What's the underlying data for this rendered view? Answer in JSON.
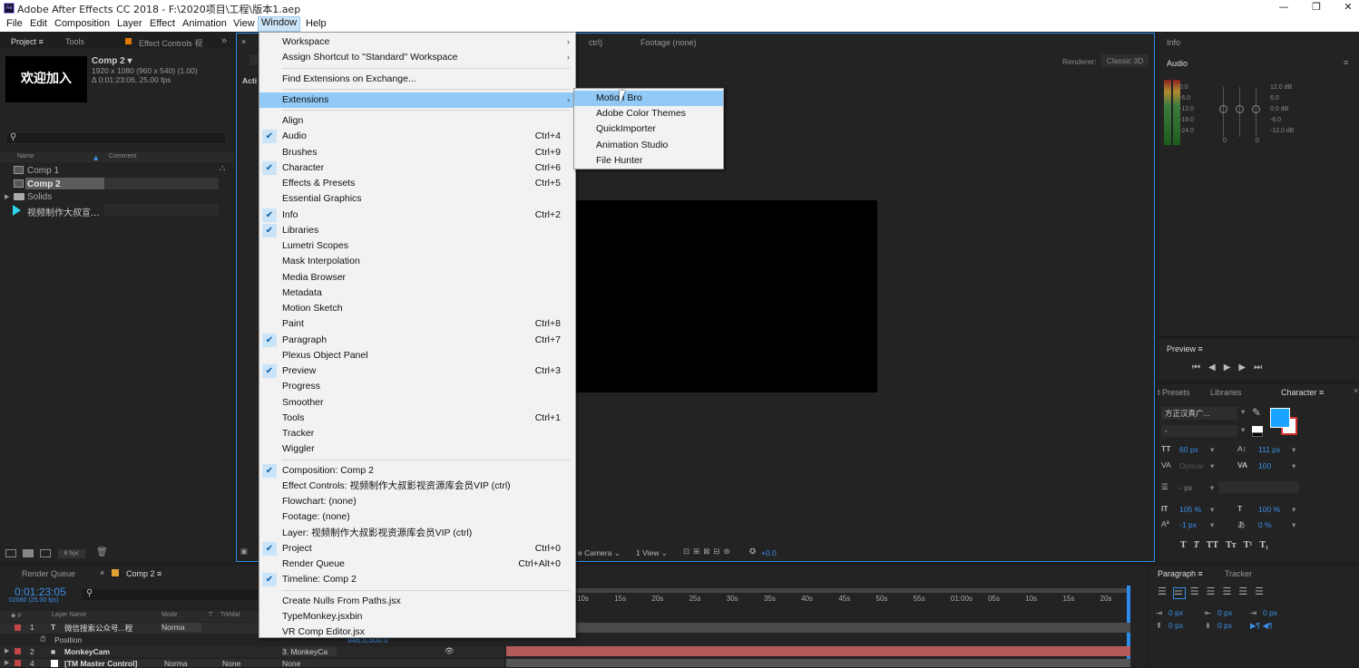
{
  "window": {
    "title": "Adobe After Effects CC 2018 - F:\\2020项目\\工程\\版本1.aep",
    "app_icon": "Ae",
    "minimize": "—",
    "maximize": "❐",
    "close": "✕"
  },
  "menubar": [
    "File",
    "Edit",
    "Composition",
    "Layer",
    "Effect",
    "Animation",
    "View",
    "Window",
    "Help"
  ],
  "project_panel": {
    "tab_project": "Project",
    "tab_tools": "Tools",
    "tab_effect_controls": "Effect Controls 视",
    "comp_name": "Comp 2 ▾",
    "comp_res": "1920 x 1080  (960 x 540) (1.00)",
    "comp_dur": "Δ 0:01:23:06, 25.00 fps",
    "thumb_text": "欢迎加入",
    "col_name": "Name",
    "col_comment": "Comment",
    "items": [
      "Comp 1",
      "Comp 2",
      "Solids",
      "视频制作大叔宣..."
    ],
    "bpc": "8 bpc"
  },
  "viewer": {
    "footage_tab": "Footage (none)",
    "ctrl_tab": "ctrl)",
    "renderer_label": "Renderer:",
    "renderer_value": "Classic 3D",
    "active_label": "Acti",
    "camera": "e Camera",
    "view": "1 View",
    "exposure": "+0.0"
  },
  "info_panel": {
    "tab_info": "Info",
    "tab_audio": "Audio",
    "audio_left": [
      "0.0",
      "-6.0",
      "-12.0",
      "-18.0",
      "-24.0"
    ],
    "audio_right": [
      "12.0 dB",
      "6.0",
      "0.0 dB",
      "-6.0",
      "-12.0 dB"
    ],
    "audio_bottom": [
      "0",
      "0"
    ]
  },
  "preview_panel": {
    "title": "Preview"
  },
  "character_panel": {
    "tab_presets": "t Presets",
    "tab_libraries": "Libraries",
    "tab_character": "Character",
    "font": "方正汉真广...",
    "style": "-",
    "size": "60 px",
    "leading": "111 px",
    "kerning": "Optical",
    "tracking": "100",
    "stroke": "- px",
    "vscale": "105 %",
    "hscale": "100 %",
    "baseline": "-1 px",
    "tsume": "0 %",
    "fill_color": "#1aa3ff",
    "styles": [
      "T",
      "T",
      "TT",
      "Tт",
      "T¹",
      "T₁"
    ]
  },
  "paragraph_panel": {
    "tab_paragraph": "Paragraph",
    "tab_tracker": "Tracker",
    "values": [
      "0 px",
      "0 px",
      "0 px",
      "0 px",
      "0 px"
    ]
  },
  "timeline": {
    "tab_render_queue": "Render Queue",
    "tab_comp": "Comp 2",
    "timecode": "0:01:23:05",
    "frame": "02080 (25.00 fps)",
    "col_layer": "Layer Name",
    "col_mode": "Mode",
    "col_t": "T",
    "col_trkmat": "TrkMat",
    "ruler": [
      "10s",
      "15s",
      "20s",
      "25s",
      "30s",
      "35s",
      "40s",
      "45s",
      "50s",
      "55s",
      "01:00s",
      "05s",
      "10s",
      "15s",
      "20s"
    ],
    "layers": [
      {
        "num": "1",
        "name": "微信搜索公众号...程",
        "mode": "Norma",
        "parent": ""
      },
      {
        "num": "",
        "name": "Position",
        "mode": "",
        "parent": "946.0,600.0"
      },
      {
        "num": "2",
        "name": "MonkeyCam",
        "mode": "",
        "parent": "3. MonkeyCa"
      },
      {
        "num": "4",
        "name": "[TM Master Control]",
        "mode": "Norma",
        "parent": "None"
      }
    ],
    "none_label": "None"
  },
  "window_menu": {
    "items": [
      {
        "label": "Workspace",
        "shortcut": "",
        "checked": false,
        "submenu": true
      },
      {
        "label": "Assign Shortcut to \"Standard\" Workspace",
        "shortcut": "",
        "checked": false,
        "submenu": true
      },
      {
        "sep": true
      },
      {
        "label": "Find Extensions on Exchange...",
        "shortcut": "",
        "checked": false
      },
      {
        "sep": true
      },
      {
        "label": "Extensions",
        "shortcut": "",
        "checked": false,
        "submenu": true,
        "highlighted": true
      },
      {
        "sep": true
      },
      {
        "label": "Align",
        "shortcut": "",
        "checked": false
      },
      {
        "label": "Audio",
        "shortcut": "Ctrl+4",
        "checked": true
      },
      {
        "label": "Brushes",
        "shortcut": "Ctrl+9",
        "checked": false
      },
      {
        "label": "Character",
        "shortcut": "Ctrl+6",
        "checked": true
      },
      {
        "label": "Effects & Presets",
        "shortcut": "Ctrl+5",
        "checked": false
      },
      {
        "label": "Essential Graphics",
        "shortcut": "",
        "checked": false
      },
      {
        "label": "Info",
        "shortcut": "Ctrl+2",
        "checked": true
      },
      {
        "label": "Libraries",
        "shortcut": "",
        "checked": true
      },
      {
        "label": "Lumetri Scopes",
        "shortcut": "",
        "checked": false
      },
      {
        "label": "Mask Interpolation",
        "shortcut": "",
        "checked": false
      },
      {
        "label": "Media Browser",
        "shortcut": "",
        "checked": false
      },
      {
        "label": "Metadata",
        "shortcut": "",
        "checked": false
      },
      {
        "label": "Motion Sketch",
        "shortcut": "",
        "checked": false
      },
      {
        "label": "Paint",
        "shortcut": "Ctrl+8",
        "checked": false
      },
      {
        "label": "Paragraph",
        "shortcut": "Ctrl+7",
        "checked": true
      },
      {
        "label": "Plexus Object Panel",
        "shortcut": "",
        "checked": false
      },
      {
        "label": "Preview",
        "shortcut": "Ctrl+3",
        "checked": true
      },
      {
        "label": "Progress",
        "shortcut": "",
        "checked": false
      },
      {
        "label": "Smoother",
        "shortcut": "",
        "checked": false
      },
      {
        "label": "Tools",
        "shortcut": "Ctrl+1",
        "checked": false
      },
      {
        "label": "Tracker",
        "shortcut": "",
        "checked": false
      },
      {
        "label": "Wiggler",
        "shortcut": "",
        "checked": false
      },
      {
        "sep": true
      },
      {
        "label": "Composition: Comp 2",
        "shortcut": "",
        "checked": true
      },
      {
        "label": "Effect Controls: 视频制作大叔影视资源库会员VIP (ctrl)",
        "shortcut": "",
        "checked": false
      },
      {
        "label": "Flowchart: (none)",
        "shortcut": "",
        "checked": false
      },
      {
        "label": "Footage: (none)",
        "shortcut": "",
        "checked": false
      },
      {
        "label": "Layer: 视频制作大叔影视资源库会员VIP (ctrl)",
        "shortcut": "",
        "checked": false
      },
      {
        "label": "Project",
        "shortcut": "Ctrl+0",
        "checked": true
      },
      {
        "label": "Render Queue",
        "shortcut": "Ctrl+Alt+0",
        "checked": false
      },
      {
        "label": "Timeline: Comp 2",
        "shortcut": "",
        "checked": true
      },
      {
        "sep": true
      },
      {
        "label": "Create Nulls From Paths.jsx",
        "shortcut": "",
        "checked": false
      },
      {
        "label": "TypeMonkey.jsxbin",
        "shortcut": "",
        "checked": false
      },
      {
        "label": "VR Comp Editor.jsx",
        "shortcut": "",
        "checked": false
      }
    ]
  },
  "extensions_submenu": {
    "items": [
      "Motion Bro",
      "Adobe Color Themes",
      "QuickImporter",
      "Animation Studio",
      "File Hunter"
    ],
    "highlighted_index": 0
  },
  "colors": {
    "accent": "#2d8ceb",
    "highlight": "#91c9f7",
    "timecode": "#3b8fe8"
  }
}
